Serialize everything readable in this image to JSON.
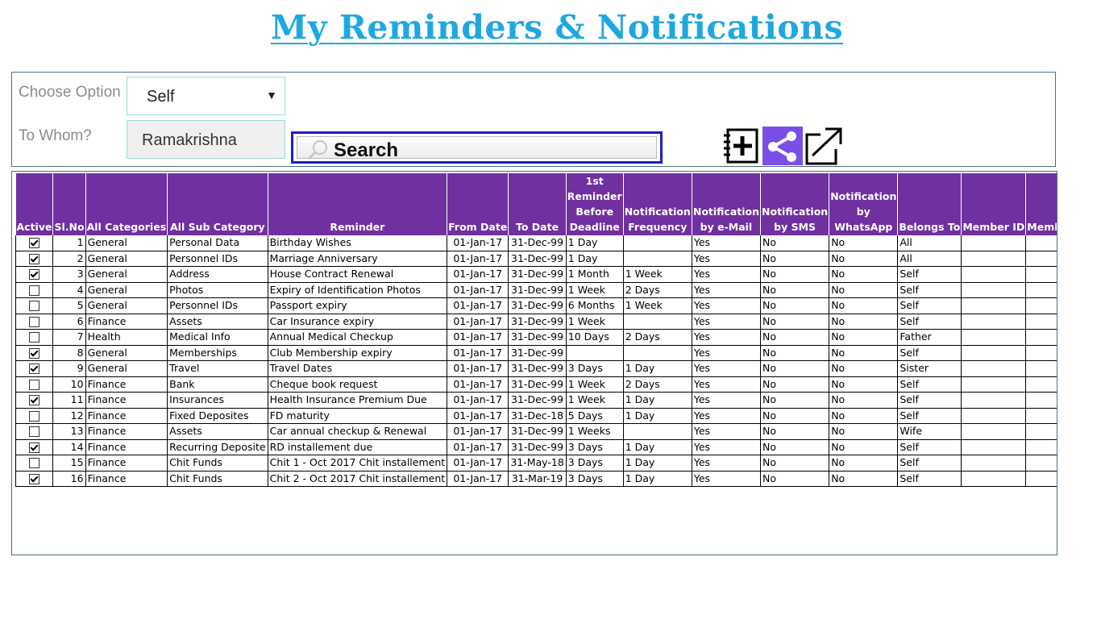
{
  "title": "My Reminders & Notifications",
  "filters": {
    "choose_option_label": "Choose Option",
    "choose_option_value": "Self",
    "to_whom_label": "To Whom?",
    "to_whom_value": "Ramakrishna",
    "search_placeholder": "Search"
  },
  "toolbar_icons": [
    "add-reminder-icon",
    "share-icon",
    "export-icon"
  ],
  "colors": {
    "title": "#1fa8e0",
    "header_bg": "#7030a0",
    "search_border": "#1f1fc2",
    "share_bg": "#7b4ee8"
  },
  "table": {
    "columns": [
      "Active",
      "Sl.No",
      "All Categories",
      "All Sub Category",
      "Reminder",
      "From Date",
      "To Date",
      "1st Reminder Before Deadline",
      "Notification Frequency",
      "Notification by e-Mail",
      "Notification by SMS",
      "Notification by WhatsApp",
      "Belongs To",
      "Member ID",
      "Member"
    ],
    "rows": [
      {
        "active": true,
        "sl": "1",
        "cat": "General",
        "sub": "Personal Data",
        "rem": "Birthday Wishes",
        "from": "01-Jan-17",
        "to": "31-Dec-99",
        "first": "1 Day",
        "freq": "",
        "email": "Yes",
        "sms": "No",
        "wa": "No",
        "belongs": "All",
        "mid": "",
        "member": ""
      },
      {
        "active": true,
        "sl": "2",
        "cat": "General",
        "sub": "Personnel IDs",
        "rem": "Marriage Anniversary",
        "from": "01-Jan-17",
        "to": "31-Dec-99",
        "first": "1 Day",
        "freq": "",
        "email": "Yes",
        "sms": "No",
        "wa": "No",
        "belongs": "All",
        "mid": "",
        "member": ""
      },
      {
        "active": true,
        "sl": "3",
        "cat": "General",
        "sub": "Address",
        "rem": "House Contract Renewal",
        "from": "01-Jan-17",
        "to": "31-Dec-99",
        "first": "1 Month",
        "freq": "1 Week",
        "email": "Yes",
        "sms": "No",
        "wa": "No",
        "belongs": "Self",
        "mid": "",
        "member": ""
      },
      {
        "active": false,
        "sl": "4",
        "cat": "General",
        "sub": "Photos",
        "rem": "Expiry of Identification Photos",
        "from": "01-Jan-17",
        "to": "31-Dec-99",
        "first": "1 Week",
        "freq": "2 Days",
        "email": "Yes",
        "sms": "No",
        "wa": "No",
        "belongs": "Self",
        "mid": "",
        "member": ""
      },
      {
        "active": false,
        "sl": "5",
        "cat": "General",
        "sub": "Personnel IDs",
        "rem": "Passport expiry",
        "from": "01-Jan-17",
        "to": "31-Dec-99",
        "first": "6 Months",
        "freq": "1 Week",
        "email": "Yes",
        "sms": "No",
        "wa": "No",
        "belongs": "Self",
        "mid": "",
        "member": ""
      },
      {
        "active": false,
        "sl": "6",
        "cat": "Finance",
        "sub": "Assets",
        "rem": "Car Insurance expiry",
        "from": "01-Jan-17",
        "to": "31-Dec-99",
        "first": "1 Week",
        "freq": "",
        "email": "Yes",
        "sms": "No",
        "wa": "No",
        "belongs": "Self",
        "mid": "",
        "member": ""
      },
      {
        "active": false,
        "sl": "7",
        "cat": "Health",
        "sub": "Medical Info",
        "rem": "Annual Medical Checkup",
        "from": "01-Jan-17",
        "to": "31-Dec-99",
        "first": "10 Days",
        "freq": "2 Days",
        "email": "Yes",
        "sms": "No",
        "wa": "No",
        "belongs": "Father",
        "mid": "",
        "member": ""
      },
      {
        "active": true,
        "sl": "8",
        "cat": "General",
        "sub": "Memberships",
        "rem": "Club Membership expiry",
        "from": "01-Jan-17",
        "to": "31-Dec-99",
        "first": "",
        "freq": "",
        "email": "Yes",
        "sms": "No",
        "wa": "No",
        "belongs": "Self",
        "mid": "",
        "member": ""
      },
      {
        "active": true,
        "sl": "9",
        "cat": "General",
        "sub": "Travel",
        "rem": "Travel Dates",
        "from": "01-Jan-17",
        "to": "31-Dec-99",
        "first": "3 Days",
        "freq": "1 Day",
        "email": "Yes",
        "sms": "No",
        "wa": "No",
        "belongs": "Sister",
        "mid": "",
        "member": ""
      },
      {
        "active": false,
        "sl": "10",
        "cat": "Finance",
        "sub": "Bank",
        "rem": "Cheque book request",
        "from": "01-Jan-17",
        "to": "31-Dec-99",
        "first": "1 Week",
        "freq": "2 Days",
        "email": "Yes",
        "sms": "No",
        "wa": "No",
        "belongs": "Self",
        "mid": "",
        "member": ""
      },
      {
        "active": true,
        "sl": "11",
        "cat": "Finance",
        "sub": "Insurances",
        "rem": "Health Insurance Premium Due",
        "from": "01-Jan-17",
        "to": "31-Dec-99",
        "first": "1 Week",
        "freq": "1 Day",
        "email": "Yes",
        "sms": "No",
        "wa": "No",
        "belongs": "Self",
        "mid": "",
        "member": ""
      },
      {
        "active": false,
        "sl": "12",
        "cat": "Finance",
        "sub": "Fixed Deposites",
        "rem": "FD maturity",
        "from": "01-Jan-17",
        "to": "31-Dec-18",
        "first": "5 Days",
        "freq": "1 Day",
        "email": "Yes",
        "sms": "No",
        "wa": "No",
        "belongs": "Self",
        "mid": "",
        "member": ""
      },
      {
        "active": false,
        "sl": "13",
        "cat": "Finance",
        "sub": "Assets",
        "rem": "Car annual checkup & Renewal",
        "from": "01-Jan-17",
        "to": "31-Dec-99",
        "first": "1 Weeks",
        "freq": "",
        "email": "Yes",
        "sms": "No",
        "wa": "No",
        "belongs": "Wife",
        "mid": "",
        "member": ""
      },
      {
        "active": true,
        "sl": "14",
        "cat": "Finance",
        "sub": "Recurring Deposite",
        "rem": "RD installement due",
        "from": "01-Jan-17",
        "to": "31-Dec-99",
        "first": "3 Days",
        "freq": "1 Day",
        "email": "Yes",
        "sms": "No",
        "wa": "No",
        "belongs": "Self",
        "mid": "",
        "member": ""
      },
      {
        "active": false,
        "sl": "15",
        "cat": "Finance",
        "sub": "Chit Funds",
        "rem": "Chit 1 - Oct 2017 Chit installement",
        "from": "01-Jan-17",
        "to": "31-May-18",
        "first": "3 Days",
        "freq": "1 Day",
        "email": "Yes",
        "sms": "No",
        "wa": "No",
        "belongs": "Self",
        "mid": "",
        "member": ""
      },
      {
        "active": true,
        "sl": "16",
        "cat": "Finance",
        "sub": "Chit Funds",
        "rem": "Chit 2 - Oct 2017 Chit installement",
        "from": "01-Jan-17",
        "to": "31-Mar-19",
        "first": "3 Days",
        "freq": "1 Day",
        "email": "Yes",
        "sms": "No",
        "wa": "No",
        "belongs": "Self",
        "mid": "",
        "member": ""
      }
    ]
  }
}
